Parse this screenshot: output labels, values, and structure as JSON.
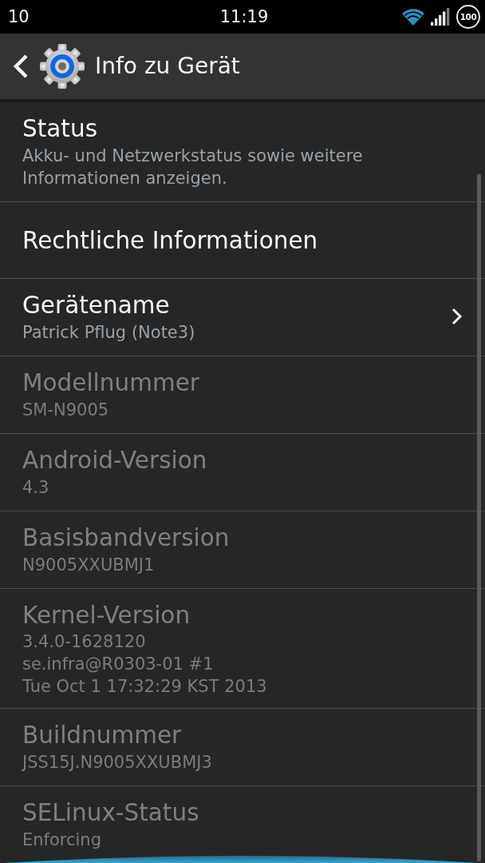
{
  "status_bar": {
    "notification_count": "10",
    "time": "11:19",
    "battery": "100"
  },
  "action_bar": {
    "title": "Info zu Gerät"
  },
  "items": [
    {
      "kind": "plain",
      "title": "Status",
      "summary": "Akku- und Netzwerkstatus sowie weitere Informationen anzeigen.",
      "disabled": false
    },
    {
      "kind": "plain",
      "title": "Rechtliche Informationen",
      "disabled": false
    },
    {
      "kind": "navigation",
      "title": "Gerätename",
      "summary": "Patrick Pflug (Note3)",
      "disabled": false
    },
    {
      "kind": "plain",
      "title": "Modellnummer",
      "summary": "SM-N9005",
      "disabled": true
    },
    {
      "kind": "plain",
      "title": "Android-Version",
      "summary": "4.3",
      "disabled": true
    },
    {
      "kind": "plain",
      "title": "Basisbandversion",
      "summary": "N9005XXUBMJ1",
      "disabled": true
    },
    {
      "kind": "plain",
      "title": "Kernel-Version",
      "summary": "3.4.0-1628120\nse.infra@R0303-01 #1\nTue Oct 1 17:32:29 KST 2013",
      "disabled": true
    },
    {
      "kind": "plain",
      "title": "Buildnummer",
      "summary": "JSS15J.N9005XXUBMJ3",
      "disabled": true
    },
    {
      "kind": "plain",
      "title": "SELinux-Status",
      "summary": "Enforcing",
      "disabled": true
    }
  ]
}
